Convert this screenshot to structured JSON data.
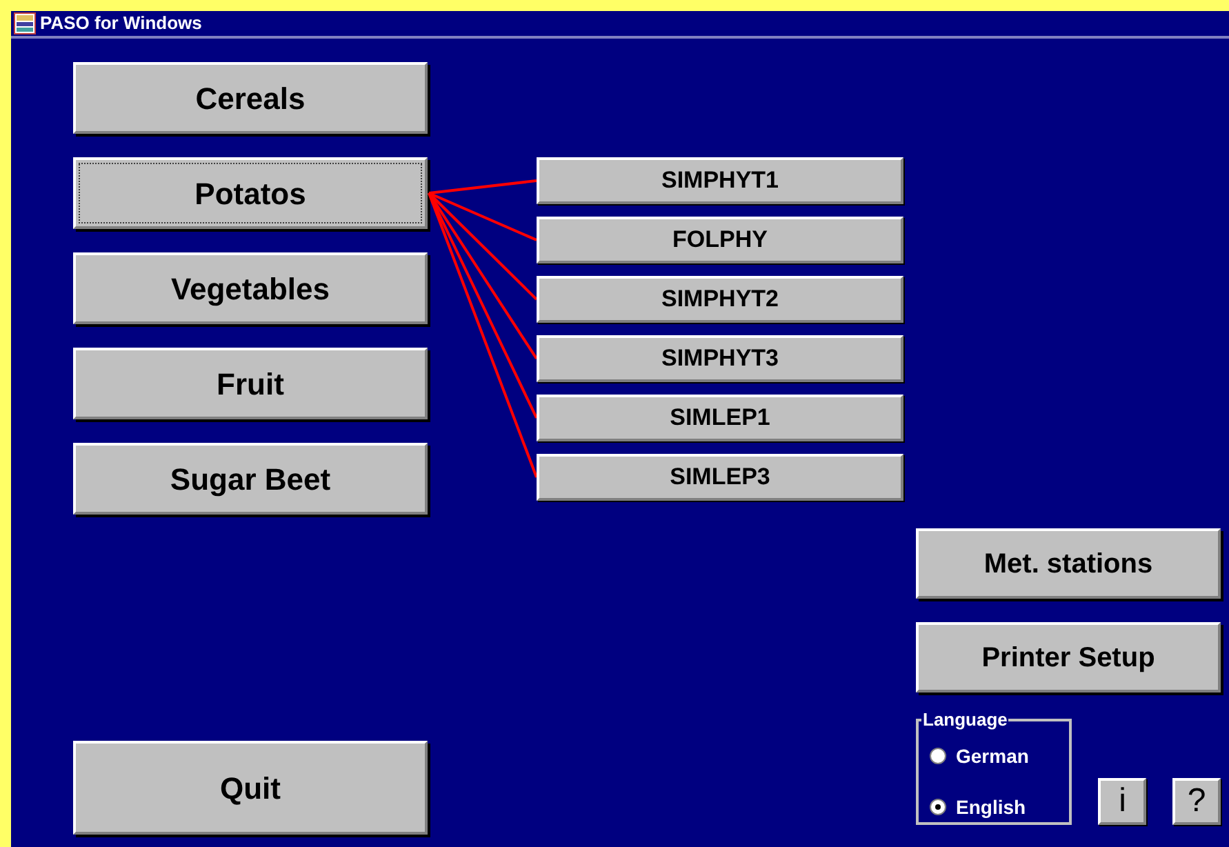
{
  "window": {
    "title": "PASO for Windows"
  },
  "crops": [
    {
      "label": "Cereals",
      "selected": false
    },
    {
      "label": "Potatos",
      "selected": true
    },
    {
      "label": "Vegetables",
      "selected": false
    },
    {
      "label": "Fruit",
      "selected": false
    },
    {
      "label": "Sugar Beet",
      "selected": false
    }
  ],
  "models": [
    "SIMPHYT1",
    "FOLPHY",
    "SIMPHYT2",
    "SIMPHYT3",
    "SIMLEP1",
    "SIMLEP3"
  ],
  "quit_button": "Quit",
  "side_buttons": [
    "Met. stations",
    "Printer Setup"
  ],
  "language": {
    "title": "Language",
    "options": [
      {
        "label": "German",
        "selected": false
      },
      {
        "label": "English",
        "selected": true
      }
    ]
  },
  "info_button": "i",
  "help_button": "?"
}
